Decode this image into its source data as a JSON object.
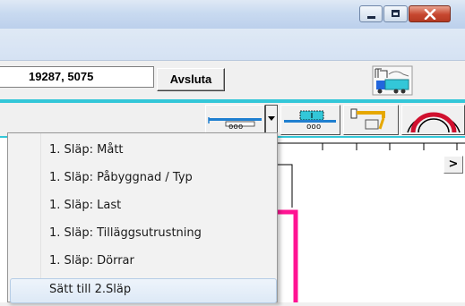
{
  "window": {
    "minimize_label": "",
    "maximize_label": "",
    "close_label": ""
  },
  "status": {
    "coordinates": "19287, 5075",
    "exit_button": "Avsluta"
  },
  "toolbar": {
    "icons": [
      "trailer-length-icon",
      "trailer-body-icon",
      "crane-icon",
      "turning-circle-icon"
    ]
  },
  "dropdown": {
    "items": [
      "1. Släp: Mått",
      "1. Släp: Påbyggnad / Typ",
      "1. Släp: Last",
      "1. Släp: Tilläggsutrustning",
      "1. Släp: Dörrar",
      "Sätt till 2.Släp"
    ]
  },
  "canvas": {
    "scroll_right_label": ">"
  },
  "colors": {
    "accent_cyan": "#33c7d8",
    "magenta": "#ff1493",
    "toolbar_blue": "#1f7fd0"
  }
}
